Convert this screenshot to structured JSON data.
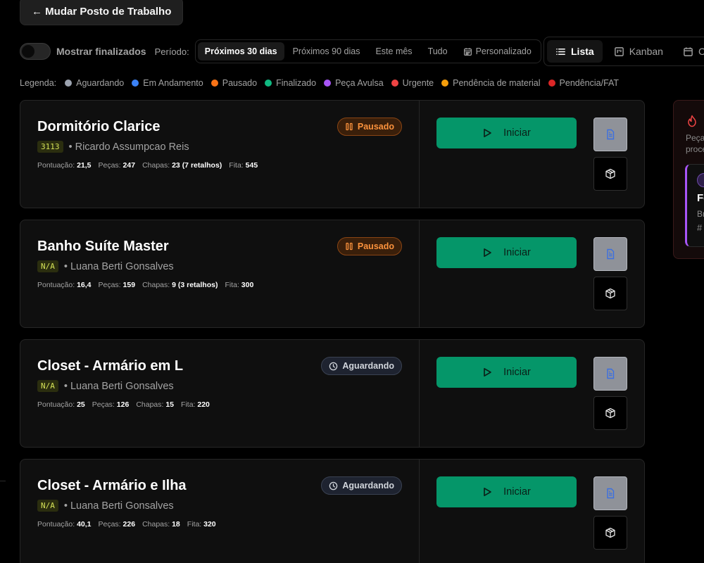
{
  "header": {
    "back_label": "← Mudar Posto de Trabalho"
  },
  "toolbar": {
    "show_finished_label": "Mostrar finalizados",
    "period_label": "Período:",
    "period_options": [
      "Próximos 30 dias",
      "Próximos 90 dias",
      "Este mês",
      "Tudo",
      "Personalizado"
    ],
    "period_selected": "Próximos 30 dias"
  },
  "views": {
    "options": [
      "Lista",
      "Kanban",
      "Ca"
    ],
    "selected": "Lista"
  },
  "legend": {
    "title": "Legenda:",
    "items": [
      {
        "label": "Aguardando",
        "color": "#9ca3af"
      },
      {
        "label": "Em Andamento",
        "color": "#3b82f6"
      },
      {
        "label": "Pausado",
        "color": "#f97316"
      },
      {
        "label": "Finalizado",
        "color": "#10b981"
      },
      {
        "label": "Peça Avulsa",
        "color": "#a855f7"
      },
      {
        "label": "Urgente",
        "color": "#ef4444"
      },
      {
        "label": "Pendência de material",
        "color": "#f59e0b"
      },
      {
        "label": "Pendência/FAT",
        "color": "#dc2626"
      }
    ]
  },
  "stat_labels": {
    "score": "Pontuação:",
    "pieces": "Peças:",
    "sheets": "Chapas:",
    "tape": "Fita:"
  },
  "start_label": "Iniciar",
  "jobs": [
    {
      "title": "Dormitório Clarice",
      "code": "3113",
      "client": "• Ricardo Assumpcao Reis",
      "status": "Pausado",
      "score": "21,5",
      "pieces": "247",
      "sheets": "23 (7 retalhos)",
      "tape": "545"
    },
    {
      "title": "Banho Suíte Master",
      "code": "N/A",
      "client": "• Luana Berti Gonsalves",
      "status": "Pausado",
      "score": "16,4",
      "pieces": "159",
      "sheets": "9 (3 retalhos)",
      "tape": "300"
    },
    {
      "title": "Closet - Armário em L",
      "code": "N/A",
      "client": "• Luana Berti Gonsalves",
      "status": "Aguardando",
      "score": "25",
      "pieces": "126",
      "sheets": "15",
      "tape": "220"
    },
    {
      "title": "Closet - Armário e Ilha",
      "code": "N/A",
      "client": "• Luana Berti Gonsalves",
      "status": "Aguardando",
      "score": "40,1",
      "pieces": "226",
      "sheets": "18",
      "tape": "320"
    }
  ],
  "side_panel": {
    "text_line1": "Peça",
    "text_line2": "proce",
    "card_title": "Fe",
    "card_sub": "Br",
    "card_hash": "#"
  }
}
